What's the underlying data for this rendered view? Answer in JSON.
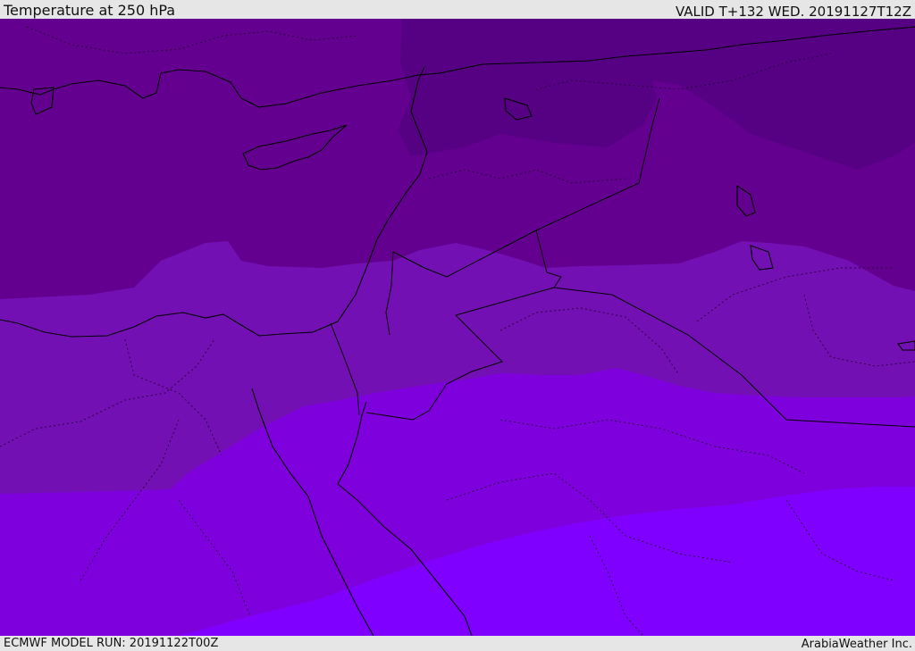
{
  "header": {
    "title": "Temperature at 250 hPa",
    "valid": "VALID T+132 WED. 20191127T12Z"
  },
  "footer": {
    "model_run": "ECMWF MODEL RUN: 20191122T00Z",
    "credit": "ArabiaWeather Inc."
  },
  "map": {
    "parameter": "Temperature",
    "level": "250 hPa",
    "band_colors": [
      "#560084",
      "#64008f",
      "#7310b3",
      "#7e00dc",
      "#7f00fe"
    ],
    "line_color": "#000000"
  }
}
